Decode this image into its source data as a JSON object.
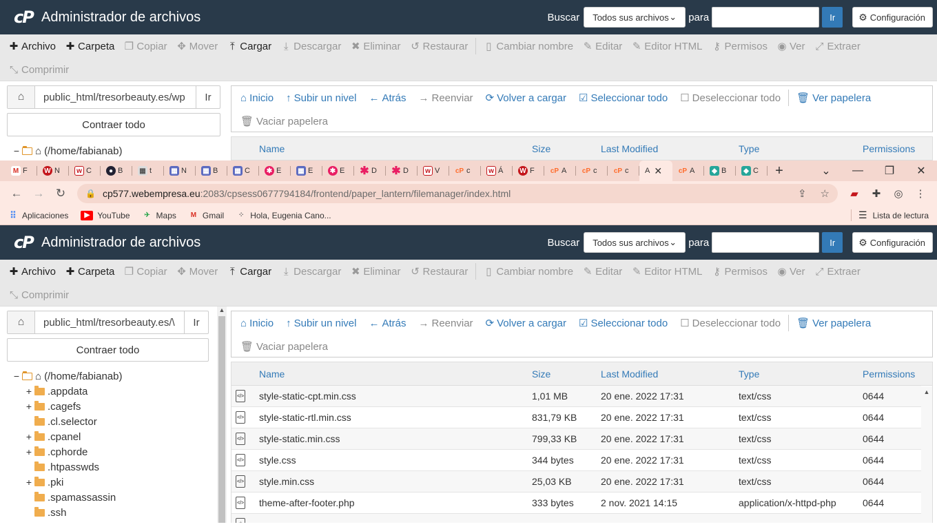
{
  "cpanel": {
    "title": "Administrador de archivos",
    "search_label": "Buscar",
    "search_scope": "Todos sus archivos",
    "para_label": "para",
    "go_label": "Ir",
    "settings_label": "Configuración"
  },
  "toolbar": {
    "archivo": "Archivo",
    "carpeta": "Carpeta",
    "copiar": "Copiar",
    "mover": "Mover",
    "cargar": "Cargar",
    "descargar": "Descargar",
    "eliminar": "Eliminar",
    "restaurar": "Restaurar",
    "cambiar_nombre": "Cambiar nombre",
    "editar": "Editar",
    "editor_html": "Editor HTML",
    "permisos": "Permisos",
    "ver": "Ver",
    "extraer": "Extraer",
    "comprimir": "Comprimir"
  },
  "path_top": "public_html/tresorbeauty.es/wp",
  "path_bottom": "public_html/tresorbeauty.es/\\",
  "go_short": "Ir",
  "collapse_all": "Contraer todo",
  "tree": {
    "root": "(/home/fabianab)",
    "items": [
      ".appdata",
      ".cagefs",
      ".cl.selector",
      ".cpanel",
      ".cphorde",
      ".htpasswds",
      ".pki",
      ".spamassassin",
      ".ssh"
    ]
  },
  "nav": {
    "inicio": "Inicio",
    "subir": "Subir un nivel",
    "atras": "Atrás",
    "reenviar": "Reenviar",
    "recargar": "Volver a cargar",
    "seleccionar": "Seleccionar todo",
    "deseleccionar": "Deseleccionar todo",
    "ver_papelera": "Ver papelera",
    "vaciar_papelera": "Vaciar papelera"
  },
  "table": {
    "headers": {
      "name": "Name",
      "size": "Size",
      "modified": "Last Modified",
      "type": "Type",
      "perms": "Permissions"
    },
    "rows": [
      {
        "name": "style-static-cpt.min.css",
        "size": "1,01 MB",
        "modified": "20 ene. 2022 17:31",
        "type": "text/css",
        "perms": "0644"
      },
      {
        "name": "style-static-rtl.min.css",
        "size": "831,79 KB",
        "modified": "20 ene. 2022 17:31",
        "type": "text/css",
        "perms": "0644"
      },
      {
        "name": "style-static.min.css",
        "size": "799,33 KB",
        "modified": "20 ene. 2022 17:31",
        "type": "text/css",
        "perms": "0644"
      },
      {
        "name": "style.css",
        "size": "344 bytes",
        "modified": "20 ene. 2022 17:31",
        "type": "text/css",
        "perms": "0644"
      },
      {
        "name": "style.min.css",
        "size": "25,03 KB",
        "modified": "20 ene. 2022 17:31",
        "type": "text/css",
        "perms": "0644"
      },
      {
        "name": "theme-after-footer.php",
        "size": "333 bytes",
        "modified": "2 nov. 2021 14:15",
        "type": "application/x-httpd-php",
        "perms": "0644"
      }
    ]
  },
  "browser": {
    "tabs": [
      "F",
      "N",
      "C",
      "B",
      "t",
      "N",
      "B",
      "C",
      "E",
      "E",
      "E",
      "D",
      "D",
      "V",
      "c",
      "Á",
      "F",
      "A",
      "c",
      "c",
      "A",
      "A",
      "B",
      "C"
    ],
    "url_host": "cp577.webempresa.eu",
    "url_rest": ":2083/cpsess0677794184/frontend/paper_lantern/filemanager/index.html",
    "bookmarks": [
      "Aplicaciones",
      "YouTube",
      "Maps",
      "Gmail",
      "Hola, Eugenia Cano..."
    ],
    "reading_list": "Lista de lectura"
  }
}
